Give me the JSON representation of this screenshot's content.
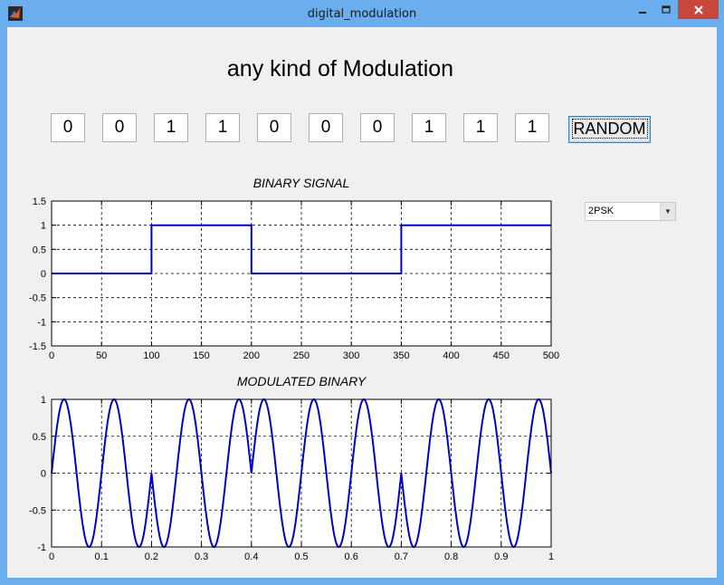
{
  "window": {
    "title": "digital_modulation"
  },
  "heading": "any kind of Modulation",
  "bits": [
    "0",
    "0",
    "1",
    "1",
    "0",
    "0",
    "0",
    "1",
    "1",
    "1"
  ],
  "random_button": "RANDOM",
  "modulation_select": {
    "selected": "2PSK"
  },
  "chart_data": [
    {
      "type": "line",
      "title": "BINARY SIGNAL",
      "xlim": [
        0,
        500
      ],
      "ylim": [
        -1.5,
        1.5
      ],
      "xticks": [
        "0",
        "50",
        "100",
        "150",
        "200",
        "250",
        "300",
        "350",
        "400",
        "450",
        "500"
      ],
      "yticks": [
        "1.5",
        "1",
        "0.5",
        "0",
        "-0.5",
        "-1",
        "-1.5"
      ],
      "grid": true,
      "series": [
        {
          "x": [
            0,
            100,
            100,
            200,
            200,
            350,
            350,
            500
          ],
          "y": [
            0,
            0,
            1,
            1,
            0,
            0,
            1,
            1
          ]
        }
      ]
    },
    {
      "type": "line",
      "title": "MODULATED BINARY",
      "xlim": [
        0,
        1
      ],
      "ylim": [
        -1,
        1
      ],
      "xticks": [
        "0",
        "0.1",
        "0.2",
        "0.3",
        "0.4",
        "0.5",
        "0.6",
        "0.7",
        "0.8",
        "0.9",
        "1"
      ],
      "yticks": [
        "1",
        "0.5",
        "0",
        "-0.5",
        "-1"
      ],
      "grid": true,
      "series": [
        {
          "function": "y = |sin(2*pi*10*x)| * (-1)^bit, bit per 0.1 interval, bits [0,0,1,1,0,0,0,1,1,1]"
        }
      ]
    }
  ]
}
